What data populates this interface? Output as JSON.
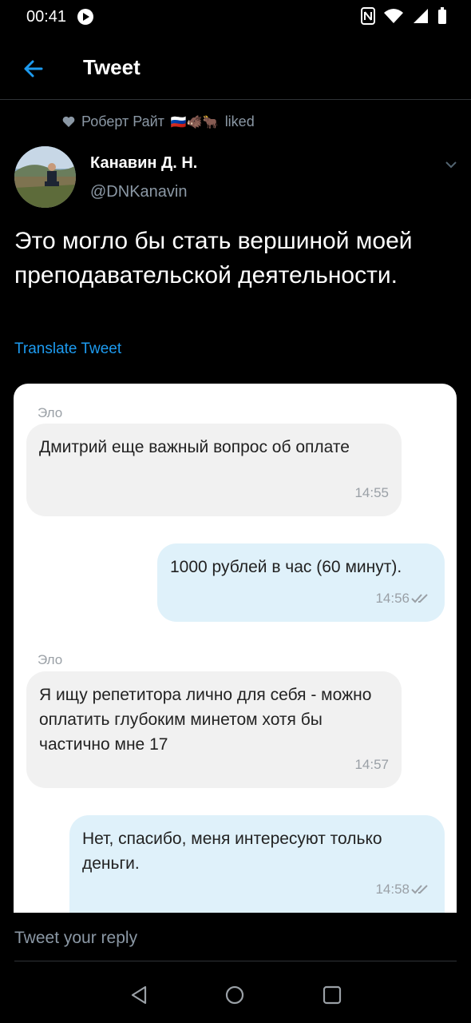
{
  "status_bar": {
    "time": "00:41"
  },
  "header": {
    "title": "Tweet"
  },
  "social_context": {
    "user": "Роберт Райт",
    "emojis": "🇷🇺🐗🐂",
    "action": "liked"
  },
  "author": {
    "name": "Канавин Д. Н.",
    "handle": "@DNKanavin"
  },
  "tweet": {
    "text": "Это могло бы стать вершиной моей преподавательской деятельности."
  },
  "translate_label": "Translate Tweet",
  "chat": {
    "messages": [
      {
        "sender": "Эло",
        "text": "Дмитрий еще важный вопрос об оплате",
        "time": "14:55",
        "direction": "in"
      },
      {
        "text": "1000 рублей в час (60 минут).",
        "time": "14:56",
        "direction": "out"
      },
      {
        "sender": "Эло",
        "text": "Я ищу репетитора лично для себя - можно оплатить глубоким минетом хотя бы частично мне 17",
        "time": "14:57",
        "direction": "in"
      },
      {
        "text": "Нет, спасибо, меня интересуют только деньги.",
        "time": "14:58",
        "direction": "out"
      }
    ]
  },
  "reply": {
    "placeholder": "Tweet your reply"
  },
  "colors": {
    "accent": "#1d9bf0",
    "background": "#000000",
    "secondary_text": "#8b98a5"
  }
}
